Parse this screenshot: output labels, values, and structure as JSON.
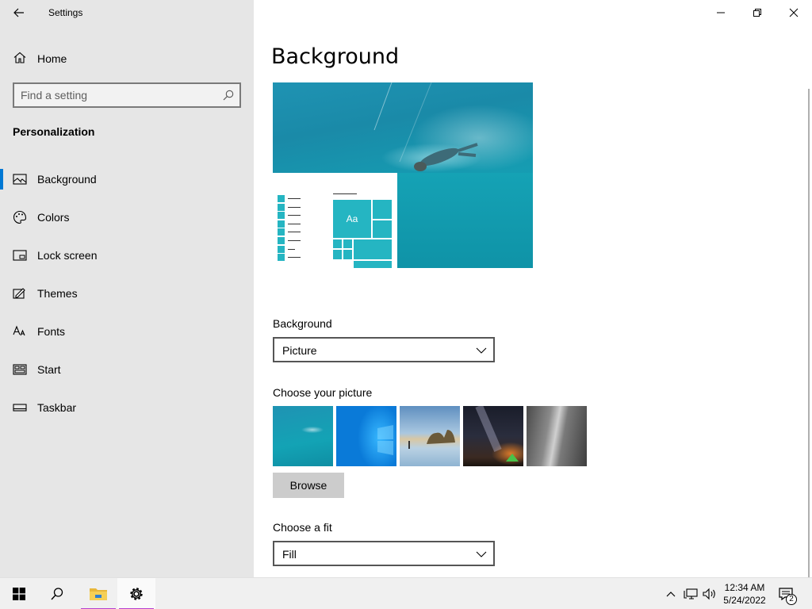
{
  "app": {
    "title": "Settings"
  },
  "sidebar": {
    "home_label": "Home",
    "search_placeholder": "Find a setting",
    "section": "Personalization",
    "items": [
      {
        "label": "Background",
        "icon": "picture-icon",
        "selected": true
      },
      {
        "label": "Colors",
        "icon": "palette-icon",
        "selected": false
      },
      {
        "label": "Lock screen",
        "icon": "lock-screen-icon",
        "selected": false
      },
      {
        "label": "Themes",
        "icon": "themes-icon",
        "selected": false
      },
      {
        "label": "Fonts",
        "icon": "fonts-icon",
        "selected": false
      },
      {
        "label": "Start",
        "icon": "start-icon",
        "selected": false
      },
      {
        "label": "Taskbar",
        "icon": "taskbar-icon",
        "selected": false
      }
    ]
  },
  "main": {
    "title": "Background",
    "preview_tile_text": "Aa",
    "background_label": "Background",
    "background_value": "Picture",
    "choose_picture_label": "Choose your picture",
    "browse_label": "Browse",
    "fit_label": "Choose a fit",
    "fit_value": "Fill"
  },
  "taskbar": {
    "time": "12:34 AM",
    "date": "5/24/2022",
    "notification_count": "2"
  },
  "colors": {
    "accent": "#0078d4",
    "sidebar_bg": "#e6e6e6",
    "tile": "#25b5c2",
    "taskbar_active": "#b73fd0"
  }
}
